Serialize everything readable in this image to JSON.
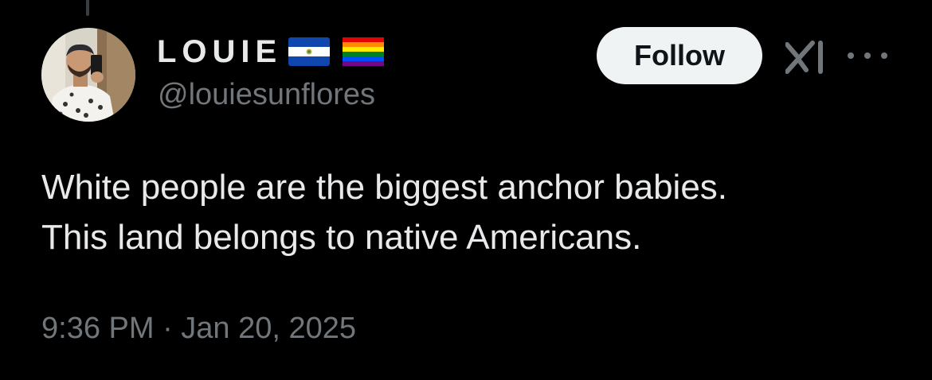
{
  "author": {
    "display_name": "LOUIE",
    "handle": "@louiesunflores",
    "avatar_icon": "profile-photo-icon",
    "name_emojis": [
      "el-salvador-flag-icon",
      "rainbow-flag-icon"
    ]
  },
  "actions": {
    "follow_label": "Follow",
    "grok_icon": "grok-icon",
    "more_icon": "more-options-icon"
  },
  "tweet": {
    "text_lines": [
      "White people are the biggest anchor babies.",
      "This land belongs to native Americans."
    ],
    "timestamp": "9:36 PM · Jan 20, 2025"
  },
  "colors": {
    "background": "#000000",
    "primary_text": "#e7e9ea",
    "secondary_text": "#71767b",
    "follow_button_bg": "#eff3f4",
    "follow_button_text": "#0f1419"
  }
}
